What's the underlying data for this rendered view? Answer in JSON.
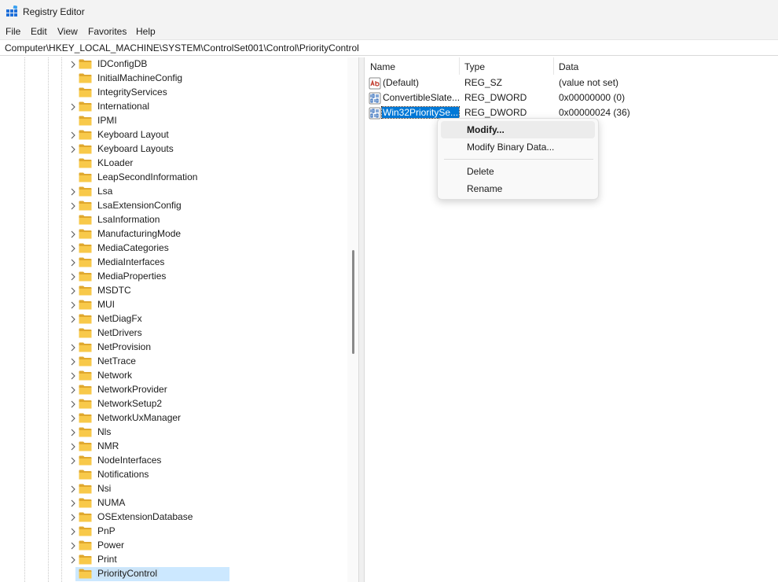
{
  "window": {
    "title": "Registry Editor"
  },
  "menu": [
    "File",
    "Edit",
    "View",
    "Favorites",
    "Help"
  ],
  "address": "Computer\\HKEY_LOCAL_MACHINE\\SYSTEM\\ControlSet001\\Control\\PriorityControl",
  "tree": {
    "items": [
      {
        "label": "IDConfigDB",
        "expandable": true
      },
      {
        "label": "InitialMachineConfig",
        "expandable": false
      },
      {
        "label": "IntegrityServices",
        "expandable": false
      },
      {
        "label": "International",
        "expandable": true
      },
      {
        "label": "IPMI",
        "expandable": false
      },
      {
        "label": "Keyboard Layout",
        "expandable": true
      },
      {
        "label": "Keyboard Layouts",
        "expandable": true
      },
      {
        "label": "KLoader",
        "expandable": false
      },
      {
        "label": "LeapSecondInformation",
        "expandable": false
      },
      {
        "label": "Lsa",
        "expandable": true
      },
      {
        "label": "LsaExtensionConfig",
        "expandable": true
      },
      {
        "label": "LsaInformation",
        "expandable": false
      },
      {
        "label": "ManufacturingMode",
        "expandable": true
      },
      {
        "label": "MediaCategories",
        "expandable": true
      },
      {
        "label": "MediaInterfaces",
        "expandable": true
      },
      {
        "label": "MediaProperties",
        "expandable": true
      },
      {
        "label": "MSDTC",
        "expandable": true
      },
      {
        "label": "MUI",
        "expandable": true
      },
      {
        "label": "NetDiagFx",
        "expandable": true
      },
      {
        "label": "NetDrivers",
        "expandable": false
      },
      {
        "label": "NetProvision",
        "expandable": true
      },
      {
        "label": "NetTrace",
        "expandable": true
      },
      {
        "label": "Network",
        "expandable": true
      },
      {
        "label": "NetworkProvider",
        "expandable": true
      },
      {
        "label": "NetworkSetup2",
        "expandable": true
      },
      {
        "label": "NetworkUxManager",
        "expandable": true
      },
      {
        "label": "Nls",
        "expandable": true
      },
      {
        "label": "NMR",
        "expandable": true
      },
      {
        "label": "NodeInterfaces",
        "expandable": true
      },
      {
        "label": "Notifications",
        "expandable": false
      },
      {
        "label": "Nsi",
        "expandable": true
      },
      {
        "label": "NUMA",
        "expandable": true
      },
      {
        "label": "OSExtensionDatabase",
        "expandable": true
      },
      {
        "label": "PnP",
        "expandable": true
      },
      {
        "label": "Power",
        "expandable": true
      },
      {
        "label": "Print",
        "expandable": true
      },
      {
        "label": "PriorityControl",
        "expandable": false,
        "selected": true
      }
    ]
  },
  "list": {
    "columns": [
      "Name",
      "Type",
      "Data"
    ],
    "rows": [
      {
        "icon": "string-value-icon",
        "name": "(Default)",
        "type": "REG_SZ",
        "data": "(value not set)"
      },
      {
        "icon": "dword-value-icon",
        "name": "ConvertibleSlate...",
        "type": "REG_DWORD",
        "data": "0x00000000 (0)"
      },
      {
        "icon": "dword-value-icon",
        "name": "Win32PrioritySe...",
        "type": "REG_DWORD",
        "data": "0x00000024 (36)",
        "selected": true
      }
    ]
  },
  "context_menu": {
    "items": [
      "Modify...",
      "Modify Binary Data...",
      "Delete",
      "Rename"
    ]
  },
  "colors": {
    "folder": "#f8c94a",
    "selection": "#0078d7",
    "tree_selection": "#cce8ff"
  }
}
